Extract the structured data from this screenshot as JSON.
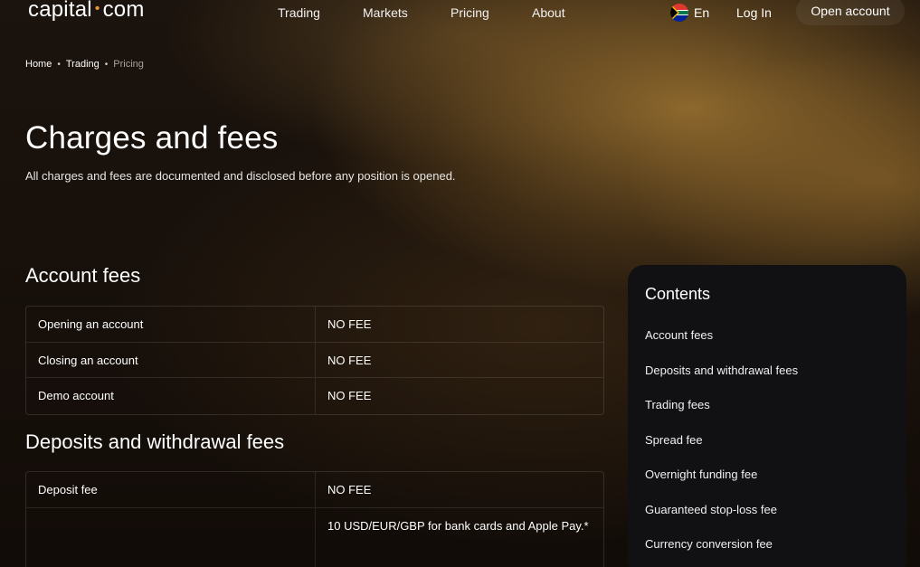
{
  "header": {
    "logo_left": "capital",
    "logo_dot": "•",
    "logo_right": "com",
    "nav": [
      {
        "label": "Trading"
      },
      {
        "label": "Markets"
      },
      {
        "label": "Pricing"
      },
      {
        "label": "About"
      }
    ],
    "language": "En",
    "language_icon": "south-africa-flag-icon",
    "login_label": "Log In",
    "open_account_label": "Open account"
  },
  "breadcrumb": {
    "items": [
      "Home",
      "Trading",
      "Pricing"
    ],
    "separator": "•"
  },
  "page": {
    "title": "Charges and fees",
    "subtitle": "All charges and fees are documented and disclosed before any position is opened."
  },
  "account_fees": {
    "title": "Account fees",
    "rows": [
      {
        "name": "Opening an account",
        "value": "NO FEE"
      },
      {
        "name": "Closing an account",
        "value": "NO FEE"
      },
      {
        "name": "Demo account",
        "value": "NO FEE"
      }
    ]
  },
  "deposits_fees": {
    "title": "Deposits and withdrawal fees",
    "rows": [
      {
        "name": "Deposit fee",
        "value": "NO FEE"
      },
      {
        "name": "",
        "value": "10 USD/EUR/GBP for bank cards  and Apple Pay.*"
      }
    ]
  },
  "contents": {
    "title": "Contents",
    "items": [
      "Account fees",
      "Deposits and withdrawal fees",
      "Trading fees",
      "Spread fee",
      "Overnight funding fee",
      "Guaranteed stop-loss fee",
      "Currency conversion fee"
    ]
  },
  "colors": {
    "accent": "#e8923a",
    "panel": "#111113",
    "background": "#160f0a"
  }
}
